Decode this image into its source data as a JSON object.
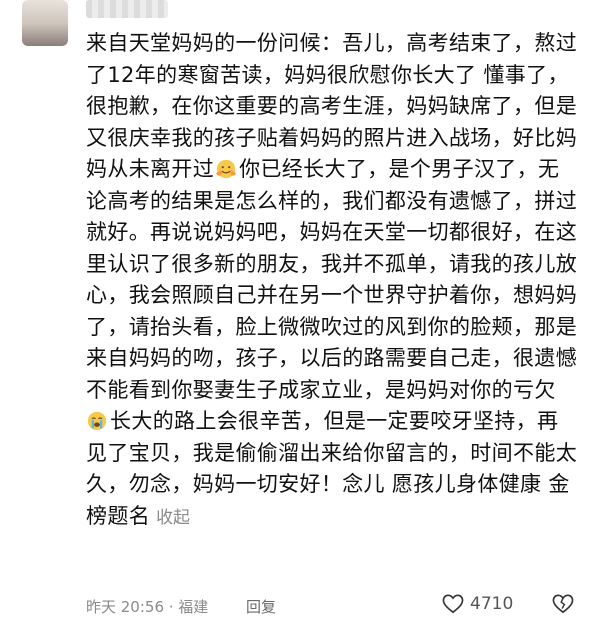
{
  "comment": {
    "lines": [
      "来自天堂妈妈的一份问候：吾儿，高考结束了，熬过",
      "了12年的寒窗苦读，妈妈很欣慰你长大了 懂事了，",
      "很抱歉，在你这重要的高考生涯，妈妈缺席了，但是",
      "又很庆幸我的孩子贴着妈妈的照片进入战场，好比妈",
      "妈从未离开过",
      "你已经长大了，是个男子汉了，无",
      "论高考的结果是怎么样的，我们都没有遗憾了，拼过",
      "就好。再说说妈妈吧，妈妈在天堂一切都很好，在这",
      "里认识了很多新的朋友，我并不孤单，请我的孩儿放",
      "心，我会照顾自己并在另一个世界守护着你，想妈妈",
      "了，请抬头看，脸上微微吹过的风到你的脸颊，那是",
      "来自妈妈的吻，孩子，以后的路需要自己走，很遗憾",
      "不能看到你娶妻生子成家立业，是妈妈对你的亏欠",
      "长大的路上会很辛苦，但是一定要咬牙坚持，再",
      "见了宝贝，我是偷偷溜出来给你留言的，时间不能太",
      "久，勿念，妈妈一切安好！念儿 愿孩儿身体健康 金",
      "榜题名"
    ],
    "collapse_label": "收起",
    "emoji_hug": "hug-emoji",
    "emoji_cry": "crying-emoji"
  },
  "footer": {
    "meta": "昨天 20:56 · 福建",
    "reply_label": "回复",
    "like_count": "4710"
  }
}
